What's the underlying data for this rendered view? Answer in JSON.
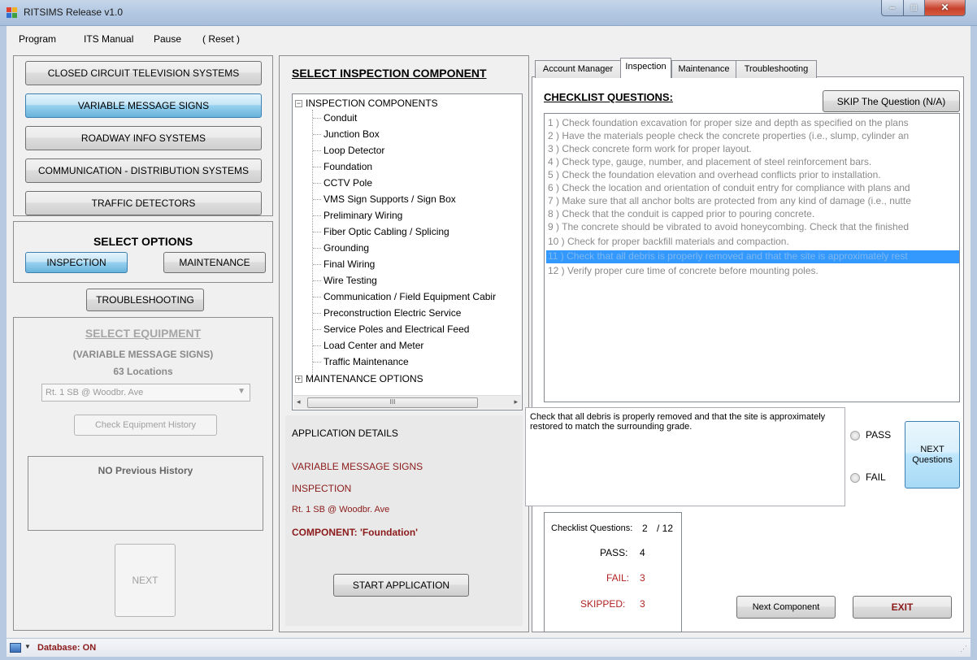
{
  "window": {
    "title": "RITSIMS Release v1.0"
  },
  "menu": [
    "Program",
    "ITS Manual",
    "Pause",
    "( Reset )"
  ],
  "systems": [
    {
      "label": "CLOSED CIRCUIT TELEVISION SYSTEMS",
      "selected": false
    },
    {
      "label": "VARIABLE MESSAGE SIGNS",
      "selected": true
    },
    {
      "label": "ROADWAY INFO SYSTEMS",
      "selected": false
    },
    {
      "label": "COMMUNICATION - DISTRIBUTION SYSTEMS",
      "selected": false
    },
    {
      "label": "TRAFFIC DETECTORS",
      "selected": false
    }
  ],
  "options": {
    "title": "SELECT OPTIONS",
    "inspection": "INSPECTION",
    "maintenance": "MAINTENANCE",
    "troubleshooting": "TROUBLESHOOTING"
  },
  "equipment": {
    "title": "SELECT EQUIPMENT",
    "system": "(VARIABLE MESSAGE SIGNS)",
    "locations": "63  Locations",
    "selected_location": "Rt. 1 SB @ Woodbr. Ave",
    "history_button": "Check Equipment History",
    "history_text": "NO Previous History",
    "next_button": "NEXT"
  },
  "component": {
    "title": "SELECT INSPECTION COMPONENT",
    "root": "INSPECTION COMPONENTS",
    "items": [
      "Conduit",
      "Junction Box",
      "Loop Detector",
      "Foundation",
      "CCTV Pole",
      "VMS Sign Supports / Sign Box",
      "Preliminary Wiring",
      "Fiber Optic Cabling / Splicing",
      "Grounding",
      "Final Wiring",
      "Wire Testing",
      "Communication / Field Equipment Cabir",
      "Preconstruction Electric Service",
      "Service Poles and Electrical Feed",
      "Load Center and Meter",
      "Traffic Maintenance"
    ],
    "root2": "MAINTENANCE OPTIONS",
    "scroll_grip": "III"
  },
  "details": {
    "title": "APPLICATION DETAILS",
    "system": "VARIABLE MESSAGE SIGNS",
    "option": "INSPECTION",
    "location": "Rt. 1 SB @ Woodbr. Ave",
    "component": "COMPONENT: 'Foundation'",
    "start_button": "START APPLICATION"
  },
  "tabs": [
    "Account Manager",
    "Inspection",
    "Maintenance",
    "Troubleshooting"
  ],
  "checklist": {
    "title": "CHECKLIST QUESTIONS:",
    "skip_button": "SKIP The Question (N/A)",
    "questions": [
      "1 ) Check foundation excavation for proper size and depth as specified on the plans",
      "2 ) Have the materials people check the concrete properties (i.e., slump, cylinder an",
      "3 ) Check concrete form work for proper layout.",
      "4 ) Check type, gauge, number, and placement of steel reinforcement bars.",
      "5 ) Check the foundation elevation and overhead conflicts prior to installation.",
      "6 ) Check the location and orientation of conduit entry for compliance with plans and",
      "7 ) Make sure that all anchor bolts are protected from any kind of damage (i.e., nutte",
      "8 ) Check that the conduit is capped prior to pouring concrete.",
      "9 ) The concrete should be vibrated to avoid honeycombing. Check that the finished",
      "10 ) Check for proper backfill materials and compaction.",
      "11 ) Check that all debris is properly removed and that the site is approximately rest",
      "12 ) Verify proper cure time of concrete before mounting poles."
    ],
    "current_text": "Check that all debris is properly removed and that the site is approximately restored to match the surrounding grade.",
    "pass_label": "PASS",
    "fail_label": "FAIL",
    "next_button": "NEXT Questions"
  },
  "stats": {
    "label": "Checklist Questions:",
    "current": "2",
    "total": "/ 12",
    "pass_label": "PASS:",
    "pass": "4",
    "fail_label": "FAIL:",
    "fail": "3",
    "skipped_label": "SKIPPED:",
    "skipped": "3"
  },
  "bottom": {
    "next_component": "Next Component",
    "exit": "EXIT"
  },
  "status": {
    "database": "Database: ON"
  },
  "colors": {
    "dark_red": "#8b1a1a",
    "selection": "#3399ff"
  }
}
